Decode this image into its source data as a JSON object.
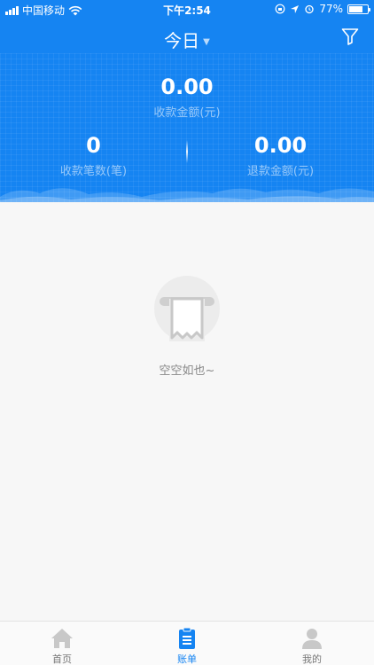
{
  "status_bar": {
    "carrier": "中国移动",
    "time": "下午2:54",
    "battery": "77%",
    "battery_level": 0.77
  },
  "header": {
    "title": "今日",
    "filter_icon": "filter-icon"
  },
  "summary": {
    "total_amount": "0.00",
    "total_label": "收款金额(元)",
    "count_value": "0",
    "count_label": "收款笔数(笔)",
    "refund_value": "0.00",
    "refund_label": "退款金额(元)"
  },
  "empty_state": {
    "text": "空空如也~",
    "icon": "receipt-icon"
  },
  "tabs": [
    {
      "label": "首页",
      "icon": "home-icon",
      "active": false
    },
    {
      "label": "账单",
      "icon": "bill-icon",
      "active": true
    },
    {
      "label": "我的",
      "icon": "user-icon",
      "active": false
    }
  ],
  "colors": {
    "primary": "#1584f2",
    "background": "#f7f7f7",
    "tab_inactive": "#c8c8c8"
  }
}
